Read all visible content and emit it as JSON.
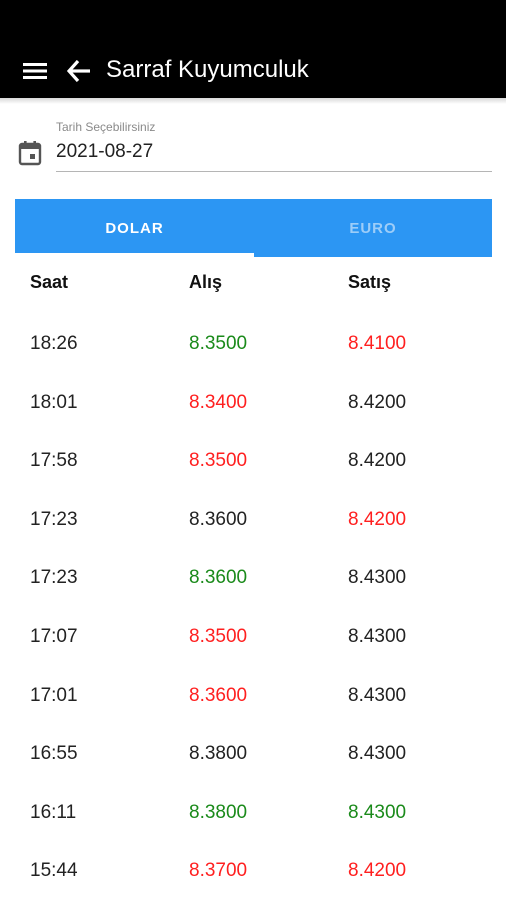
{
  "appbar": {
    "title": "Sarraf Kuyumculuk",
    "menu_icon": "menu-icon",
    "back_icon": "arrow-back-icon"
  },
  "date_picker": {
    "label": "Tarih Seçebilirsiniz",
    "value": "2021-08-27",
    "icon": "calendar-icon"
  },
  "tabs": [
    {
      "label": "DOLAR",
      "active": true
    },
    {
      "label": "EURO",
      "active": false
    }
  ],
  "table": {
    "headers": {
      "time": "Saat",
      "buy": "Alış",
      "sell": "Satış"
    },
    "rows": [
      {
        "time": "18:26",
        "buy": "8.3500",
        "buy_color": "green",
        "sell": "8.4100",
        "sell_color": "red"
      },
      {
        "time": "18:01",
        "buy": "8.3400",
        "buy_color": "red",
        "sell": "8.4200",
        "sell_color": "black"
      },
      {
        "time": "17:58",
        "buy": "8.3500",
        "buy_color": "red",
        "sell": "8.4200",
        "sell_color": "black"
      },
      {
        "time": "17:23",
        "buy": "8.3600",
        "buy_color": "black",
        "sell": "8.4200",
        "sell_color": "red"
      },
      {
        "time": "17:23",
        "buy": "8.3600",
        "buy_color": "green",
        "sell": "8.4300",
        "sell_color": "black"
      },
      {
        "time": "17:07",
        "buy": "8.3500",
        "buy_color": "red",
        "sell": "8.4300",
        "sell_color": "black"
      },
      {
        "time": "17:01",
        "buy": "8.3600",
        "buy_color": "red",
        "sell": "8.4300",
        "sell_color": "black"
      },
      {
        "time": "16:55",
        "buy": "8.3800",
        "buy_color": "black",
        "sell": "8.4300",
        "sell_color": "black"
      },
      {
        "time": "16:11",
        "buy": "8.3800",
        "buy_color": "green",
        "sell": "8.4300",
        "sell_color": "green"
      },
      {
        "time": "15:44",
        "buy": "8.3700",
        "buy_color": "red",
        "sell": "8.4200",
        "sell_color": "red"
      }
    ]
  },
  "colors": {
    "appbar": "#000000",
    "tab_bar": "#2c96f3",
    "up": "#1a8a1a",
    "down": "#ff1f1f"
  }
}
